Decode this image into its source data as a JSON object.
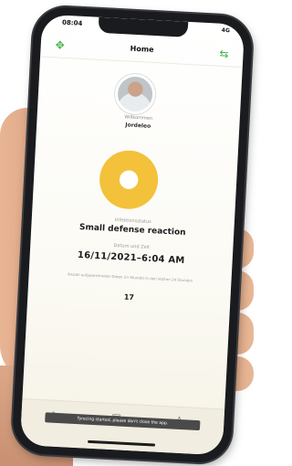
{
  "status_bar": {
    "time": "08:04",
    "signal": "4G"
  },
  "nav": {
    "title": "Home"
  },
  "profile": {
    "welcome": "Willkommen",
    "username": "Jordeleo"
  },
  "status_info": {
    "label": "Infektionsstatus",
    "value": "Small defense reaction"
  },
  "datetime": {
    "label": "Datum und Zeit",
    "value": "16/11/2021–6:04 AM"
  },
  "count": {
    "label": "Anzahl aufgezeichneter Daten (in Stunde) in den letzten 24 Stunden",
    "value": "17"
  },
  "toast": {
    "text": "Tyrecing started, please don't close the app."
  },
  "colors": {
    "accent": "#43b24a",
    "status_yellow": "#f3c13a"
  },
  "icons": {
    "nav_left": "move-arrows-icon",
    "nav_right": "swap-arrows-icon",
    "tab_1": "home-icon",
    "tab_2": "document-icon",
    "tab_3": "user-icon"
  }
}
